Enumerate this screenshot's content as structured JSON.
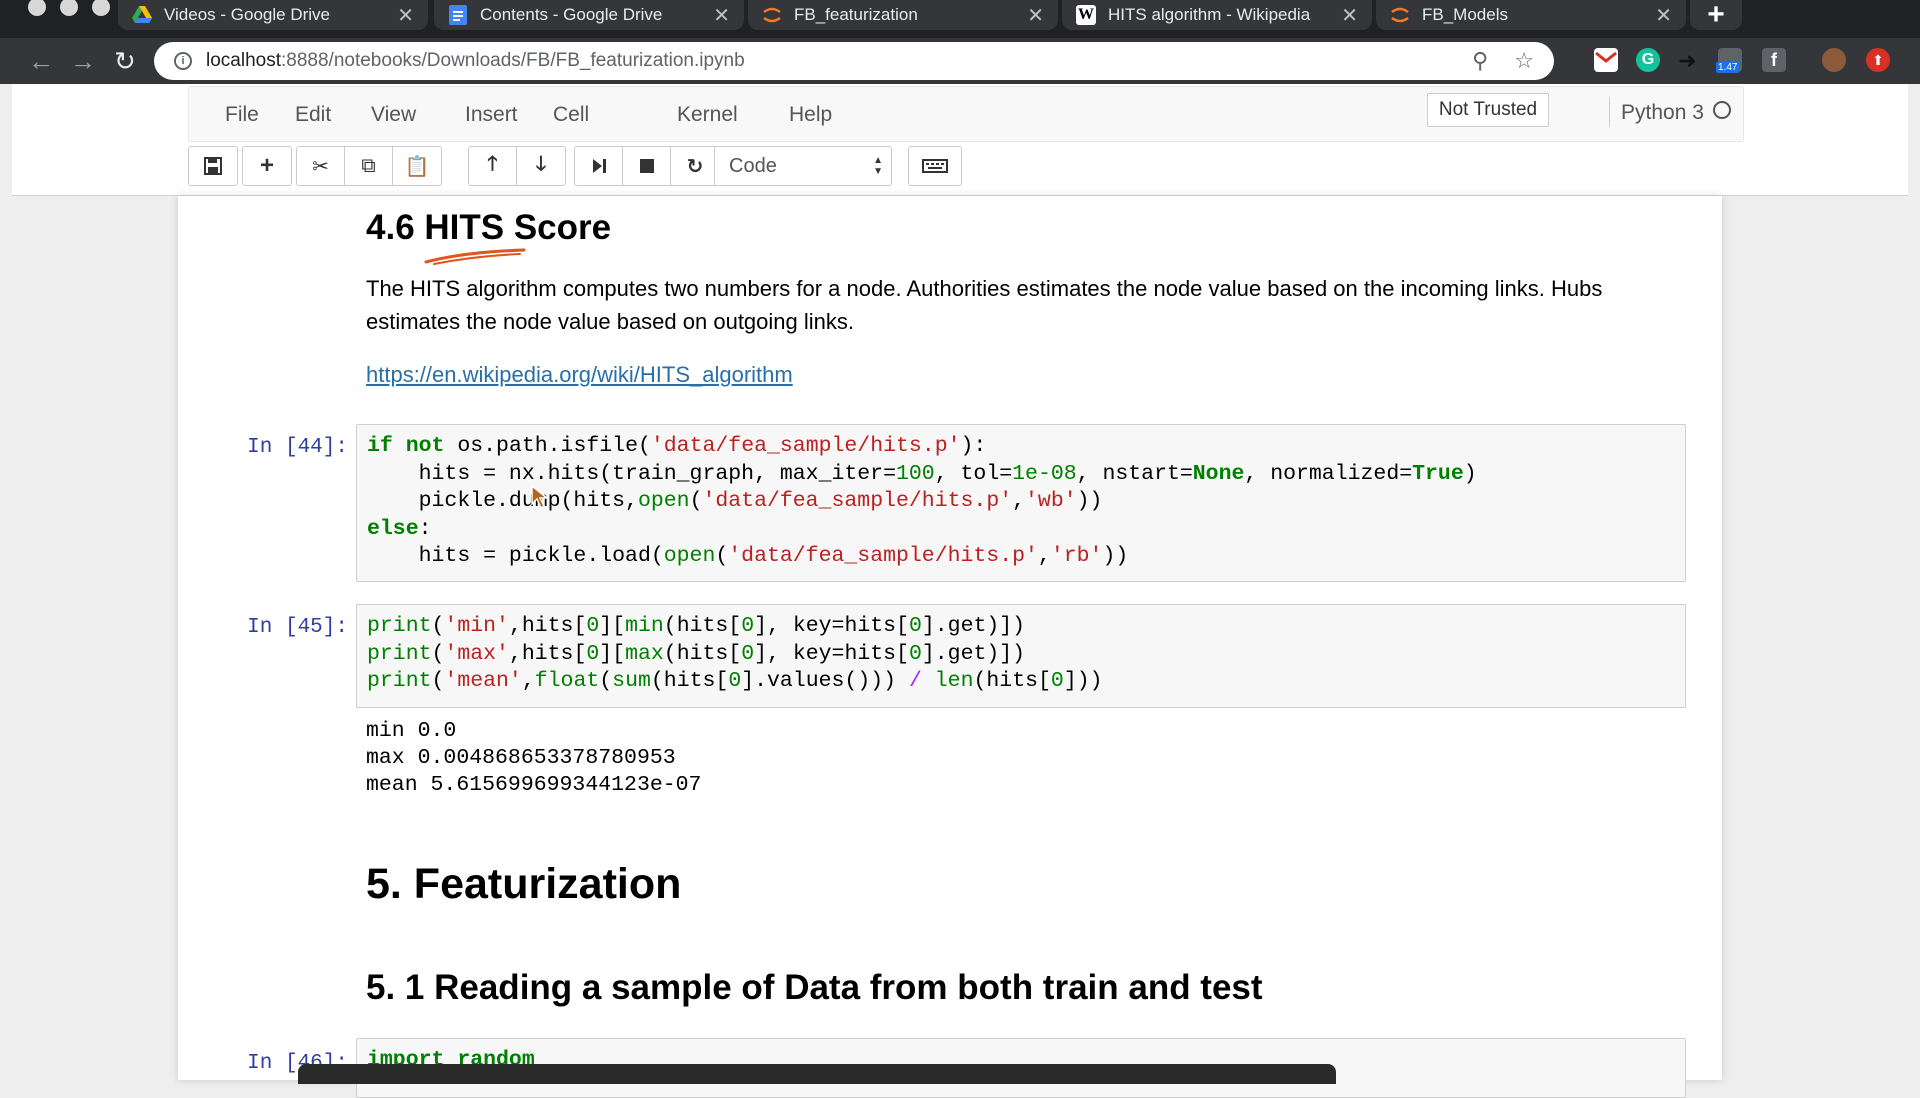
{
  "browser": {
    "tabs": [
      {
        "title": "Videos - Google Drive",
        "icon": "google-drive-icon"
      },
      {
        "title": "Contents - Google Drive",
        "icon": "google-docs-icon"
      },
      {
        "title": "FB_featurization",
        "icon": "jupyter-icon",
        "active": true
      },
      {
        "title": "HITS algorithm - Wikipedia",
        "icon": "wikipedia-icon"
      },
      {
        "title": "FB_Models",
        "icon": "jupyter-icon"
      }
    ],
    "url_host": "localhost",
    "url_path": ":8888/notebooks/Downloads/FB/FB_featurization.ipynb",
    "extension_badge": "1.47"
  },
  "jupyter": {
    "menu": [
      "File",
      "Edit",
      "View",
      "Insert",
      "Cell",
      "Kernel",
      "Help"
    ],
    "trusted": "Not Trusted",
    "kernel": "Python 3",
    "cell_type": "Code"
  },
  "notebook": {
    "heading_hits": "4.6 HITS Score",
    "hits_paragraph": "The HITS algorithm computes two numbers for a node. Authorities estimates the node value based on the incoming links. Hubs estimates the node value based on outgoing links.",
    "hits_link": "https://en.wikipedia.org/wiki/HITS_algorithm",
    "cell44_prompt": "In [44]:",
    "cell45_prompt": "In [45]:",
    "cell46_prompt": "In [46]:",
    "output45": [
      "min 0.0",
      "max 0.004868653378780953",
      "mean 5.615699699344123e-07"
    ],
    "heading_featurization": "5. Featurization",
    "heading_reading": "5. 1 Reading a sample of Data from both train and test",
    "cell46_partial": "import random"
  }
}
